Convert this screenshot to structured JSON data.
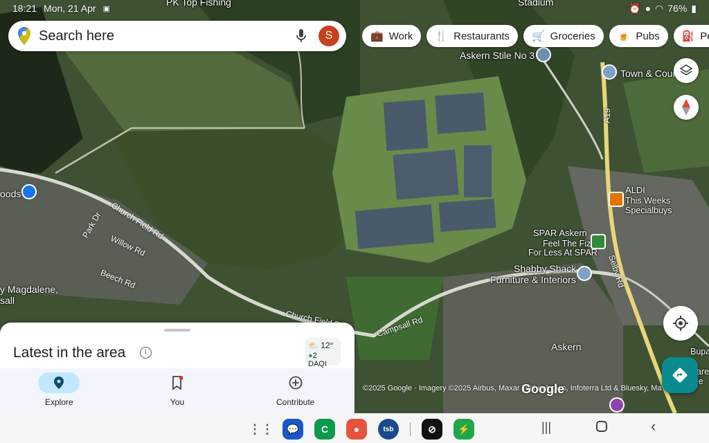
{
  "status_bar": {
    "time": "18:21",
    "date": "Mon, 21 Apr",
    "battery": "76%"
  },
  "search": {
    "placeholder": "Search here",
    "avatar_initial": "S"
  },
  "chips": [
    {
      "label": "Work",
      "icon": "briefcase-icon"
    },
    {
      "label": "Restaurants",
      "icon": "fork-knife-icon"
    },
    {
      "label": "Groceries",
      "icon": "cart-icon"
    },
    {
      "label": "Pubs",
      "icon": "beer-icon"
    },
    {
      "label": "Petrol",
      "icon": "fuel-icon"
    }
  ],
  "map_labels": {
    "top_cut": "PK Top Fishing",
    "stadium": "Stadium",
    "askern_stile": "Askern Stile No 3",
    "town_council": "Town & Cour",
    "a19": "A19",
    "aldi_name": "ALDI",
    "aldi_sub1": "This Weeks",
    "aldi_sub2": "Specialbuys",
    "spar_name": "SPAR Askern",
    "spar_sub1": "Feel The Fizz",
    "spar_sub2": "For Less At SPAR",
    "shabby1": "Shabby Shack",
    "shabby2": "Furniture & Interiors",
    "church_field": "Church Field Rd",
    "church_field2": "Church Field Rd",
    "campsall": "Campsall Rd",
    "park_dr": "Park Dr",
    "willow": "Willow Rd",
    "beech": "Beech Rd",
    "selby": "Selby Rd",
    "askern": "Askern",
    "woods": "oods",
    "magdalene1": "y Magdalene,",
    "magdalene2": "sall",
    "bupa1": "Bupa",
    "bupa2": "Care",
    "bupa3": "Cle"
  },
  "bottom_sheet": {
    "title": "Latest in the area",
    "temperature": "12°",
    "aqi": "2 DAQI"
  },
  "bottom_nav": [
    {
      "label": "Explore",
      "icon": "pin-icon",
      "active": true
    },
    {
      "label": "You",
      "icon": "bookmark-icon",
      "active": false
    },
    {
      "label": "Contribute",
      "icon": "plus-circle-icon",
      "active": false
    }
  ],
  "attribution": "©2025 Google · Imagery ©2025 Airbus, Maxar Technologies, Infoterra Ltd & Bluesky, Ma",
  "google_logo": "Google",
  "dock_apps": [
    {
      "name": "app-drawer",
      "color": "#777777"
    },
    {
      "name": "messages",
      "color": "#1a56c8"
    },
    {
      "name": "phone",
      "color": "#0a9b4e"
    },
    {
      "name": "contacts",
      "color": "#e5533d"
    },
    {
      "name": "tsb",
      "color": "#1b4a8c"
    },
    {
      "name": "perplexity",
      "color": "#111111"
    },
    {
      "name": "charging",
      "color": "#22a64a"
    }
  ]
}
